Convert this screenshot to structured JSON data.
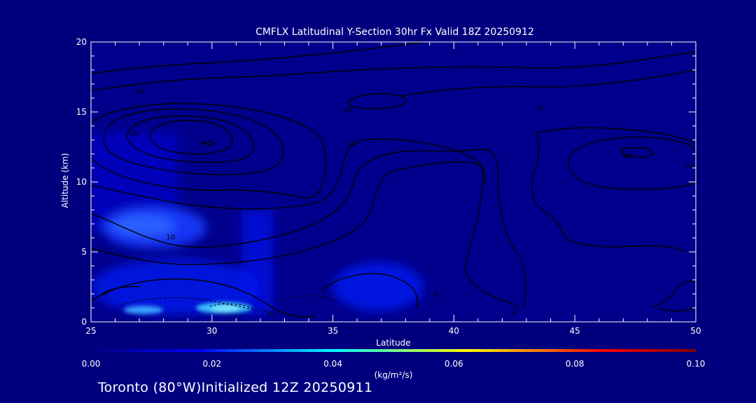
{
  "chart_data": {
    "type": "contour",
    "title": "CMFLX Latitudinal Y-Section 30hr  Fx Valid 18Z 20250912",
    "xlabel": "Latitude",
    "ylabel": "Altitude (km)",
    "xlim": [
      25,
      50
    ],
    "ylim": [
      0,
      20
    ],
    "x_ticks": [
      25,
      30,
      35,
      40,
      45,
      50
    ],
    "y_ticks": [
      0,
      5,
      10,
      15,
      20
    ],
    "colorbar": {
      "ticks": [
        "0.00",
        "0.02",
        "0.04",
        "0.06",
        "0.08",
        "0.10"
      ],
      "range": [
        0,
        0.1
      ],
      "units_label": "(kg/m²/s)",
      "colors": [
        "#00007f",
        "#0000ff",
        "#00ffff",
        "#ffff00",
        "#ff0000",
        "#7f0000"
      ]
    },
    "filled_regions": [
      {
        "lat": [
          25.0,
          28.5
        ],
        "alt": [
          7.5,
          13.5
        ],
        "value": 0.006
      },
      {
        "lat": [
          25.5,
          30.0
        ],
        "alt": [
          5.5,
          8.0
        ],
        "value": 0.012
      },
      {
        "lat": [
          32.0,
          33.5
        ],
        "alt": [
          5.0,
          8.0
        ],
        "value": 0.006
      },
      {
        "lat": [
          35.0,
          38.5
        ],
        "alt": [
          0.5,
          4.0
        ],
        "value": 0.008
      },
      {
        "lat": [
          26.5,
          28.0
        ],
        "alt": [
          0.2,
          0.8
        ],
        "value": 0.02
      },
      {
        "lat": [
          29.5,
          31.5
        ],
        "alt": [
          0.2,
          1.0
        ],
        "value": 0.025
      }
    ],
    "contour_labels": [
      {
        "text": "10",
        "lat": 27.0,
        "alt": 16.5
      },
      {
        "text": "10",
        "lat": 35.6,
        "alt": 15.2
      },
      {
        "text": "10",
        "lat": 35.8,
        "alt": 12.8
      },
      {
        "text": "20",
        "lat": 26.8,
        "alt": 13.5
      },
      {
        "text": "5",
        "lat": 43.6,
        "alt": 15.3
      },
      {
        "text": "20",
        "lat": 47.2,
        "alt": 11.9
      },
      {
        "text": "10",
        "lat": 28.3,
        "alt": 6.1
      },
      {
        "text": "0",
        "lat": 25.6,
        "alt": 2.0
      },
      {
        "text": "10",
        "lat": 32.4,
        "alt": 0.6
      },
      {
        "text": "0",
        "lat": 39.3,
        "alt": 2.0
      }
    ]
  },
  "footer": {
    "text": "Toronto (80°W)Initialized 12Z 20250911"
  }
}
